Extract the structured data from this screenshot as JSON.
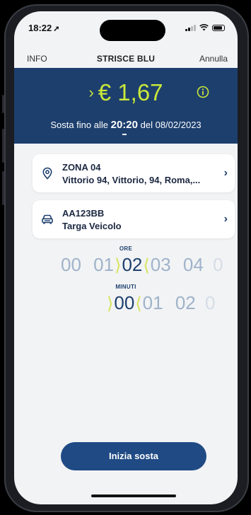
{
  "status": {
    "time": "18:22",
    "location_arrow": "➚"
  },
  "nav": {
    "left": "INFO",
    "title": "STRISCE BLU",
    "right": "Annulla"
  },
  "hero": {
    "chevron": "›",
    "price": "€ 1,67",
    "sub_prefix": "Sosta fino alle",
    "end_time": "20:20",
    "sub_mid": "del",
    "end_date": "08/02/2023"
  },
  "zone_card": {
    "title": "ZONA 04",
    "address": "Vittorio 94, Vittorio, 94, Roma,..."
  },
  "vehicle_card": {
    "plate": "AA123BB",
    "label": "Targa Veicolo"
  },
  "hours": {
    "label": "ORE",
    "prev": [
      "00",
      "01"
    ],
    "selected": "02",
    "next": [
      "03",
      "04"
    ],
    "faint": "0"
  },
  "minutes": {
    "label": "MINUTI",
    "selected": "00",
    "next": [
      "01",
      "02"
    ],
    "faint": "0"
  },
  "cta": {
    "label": "Inizia sosta"
  },
  "colors": {
    "primary": "#1d3f6e",
    "accent": "#c9e83a",
    "background": "#f2f3f5"
  }
}
